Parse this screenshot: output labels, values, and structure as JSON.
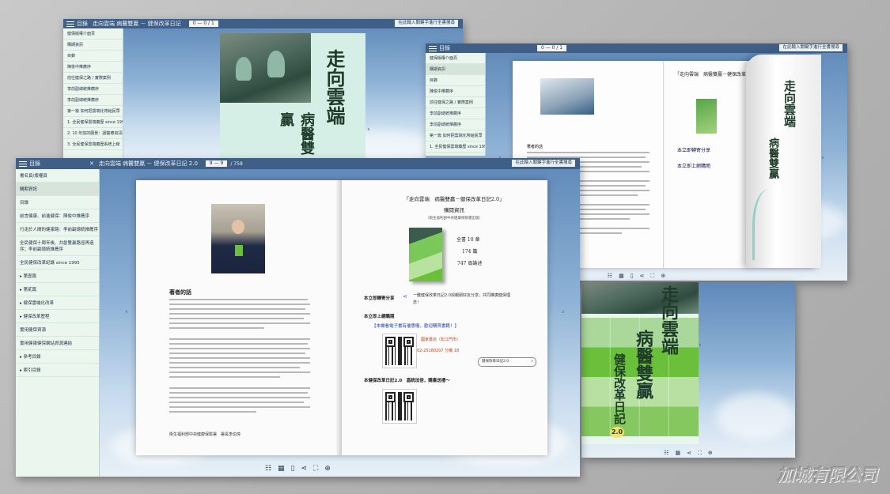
{
  "colors": {
    "topbar": "#3f5f86",
    "sidebar_bg": "#eaf6ee",
    "sidebar_header": "#bfe6d4",
    "sky": "#8fb3d6",
    "book_green": "#6abf3b"
  },
  "viewer": {
    "title_short": "走向雲端 病醫雙贏 － 健保改革日記",
    "title": "走向雲端 病醫雙贏 － 健保改革日記 2.0",
    "page_display": "0 — 0 / 1",
    "page_range": "8 — 9",
    "page_total": "/ 758",
    "search_label": "在此輸入關鍵字進行全書搜尋",
    "menu_label": "目錄",
    "close_icon": "close-icon"
  },
  "sidebar": {
    "items": [
      {
        "label": "書名頁/版權頁"
      },
      {
        "label": "購期資訊"
      },
      {
        "label": "目錄"
      },
      {
        "label": "前言健康、前進健保：陳俊中推薦序"
      },
      {
        "label": "行走於人間的健康路：李前副總統推薦序"
      },
      {
        "label": "全民健保十周年後、共創雙贏路徑再造序；李前副總統推薦序"
      },
      {
        "label": "全民健保改革紀錄 since 1995"
      },
      {
        "label": "第壹篇"
      },
      {
        "label": "第貳篇"
      },
      {
        "label": "健保雲端化改革"
      },
      {
        "label": "健保改革歷程"
      },
      {
        "label": "實用健保資源"
      },
      {
        "label": "實用健康健保網站資源連結"
      },
      {
        "label": "參考目錄"
      },
      {
        "label": "索引目錄"
      }
    ],
    "small_items": [
      {
        "label": "健保版權介面頁"
      },
      {
        "label": "購期資訊"
      },
      {
        "label": "目錄"
      },
      {
        "label": "陳俊中推薦序"
      },
      {
        "label": "前往健保之路 / 實際案例"
      },
      {
        "label": "李前副總統推薦序"
      },
      {
        "label": "李前副總統推薦序"
      },
      {
        "label": "第一篇 如何把雲端化帶給民眾"
      },
      {
        "label": "1. 全民健保雲端藥歷 since 1995"
      },
      {
        "label": "2. 10 年前的願景：讓醫療資訊跟我們走下去（健保雲）"
      },
      {
        "label": "3. 全民健保雲端藥歷系統上線"
      },
      {
        "label": "4. 雲端藥歷：健保改革日記（實際案例）"
      },
      {
        "label": "5. 雲端醫療資訊查詢系統"
      }
    ]
  },
  "book": {
    "cover_title": "走向雲端",
    "cover_sub": "病醫雙贏",
    "cover_line": "健保改革日記",
    "cover_version": "2.0",
    "left_page": {
      "section": "著者的話",
      "signature": "衛生福利部中央健康保險署　署長李伯璋"
    },
    "right_page": {
      "title": "「走向雲端　病醫雙贏－健保改革日記2.0」",
      "subtitle": "購閱資訊",
      "note": "（衛生福利部中央健康保險署出版）",
      "stats": [
        "全書 10 章",
        "174 篇",
        "747 頁論述"
      ],
      "share_label": "本立即轉寄分享",
      "share_text": "一鍵健保改革日記2.0與親朋好友分享，共同推廣健保理念！",
      "online_label": "本立即上網購閱",
      "online_text": "【本機看電子書有優惠喔，歡迎購買書籍！】",
      "store_label": "國家書店（松江門市）",
      "store_phone": "02-25180207 分機 18",
      "search_hint": "健保改革日記2.0",
      "qr_caption": "本健保改革日記2.0　嘉統加倍，購書送禮～"
    }
  },
  "watermark": "加城有限公司"
}
